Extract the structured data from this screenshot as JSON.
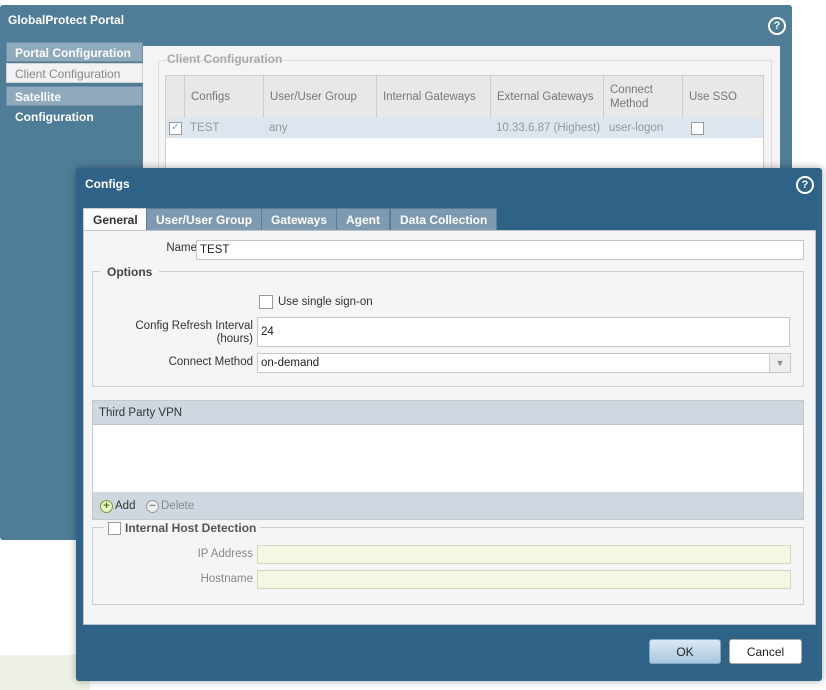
{
  "portal": {
    "title": "GlobalProtect Portal",
    "help_icon": "help-circle-icon",
    "nav": [
      {
        "label": "Portal Configuration",
        "active": false
      },
      {
        "label": "Client Configuration",
        "active": true
      },
      {
        "label": "Satellite Configuration",
        "active": false
      }
    ],
    "section_title": "Client Configuration",
    "table": {
      "headers": [
        "Configs",
        "User/User Group",
        "Internal Gateways",
        "External Gateways",
        "Connect Method",
        "Use SSO"
      ],
      "rows": [
        {
          "checked": true,
          "configs": "TEST",
          "user_group": "any",
          "internal_gateways": "",
          "external_gateways": "10.33.6.87 (Highest)",
          "connect_method": "user-logon",
          "use_sso": false
        }
      ]
    }
  },
  "dialog": {
    "title": "Configs",
    "help_icon": "help-circle-icon",
    "tabs": [
      {
        "label": "General",
        "active": true
      },
      {
        "label": "User/User Group",
        "active": false
      },
      {
        "label": "Gateways",
        "active": false
      },
      {
        "label": "Agent",
        "active": false
      },
      {
        "label": "Data Collection",
        "active": false
      }
    ],
    "name_label": "Name",
    "name_value": "TEST",
    "options_legend": "Options",
    "sso_label": "Use single sign-on",
    "sso_checked": false,
    "refresh_label_line1": "Config Refresh Interval",
    "refresh_label_line2": "(hours)",
    "refresh_value": "24",
    "connect_method_label": "Connect Method",
    "connect_method_value": "on-demand",
    "third_party_vpn_header": "Third Party VPN",
    "add_label": "Add",
    "delete_label": "Delete",
    "ihd_label": "Internal Host Detection",
    "ihd_checked": false,
    "ip_label": "IP Address",
    "ip_value": "",
    "hostname_label": "Hostname",
    "hostname_value": "",
    "ok_label": "OK",
    "cancel_label": "Cancel"
  },
  "colors": {
    "window_blue": "#4f7d98",
    "dialog_blue": "#2e6387",
    "tab_inactive": "#7d9ab1",
    "grid_header": "#cfd8e0",
    "disabled_input": "#f6f7e2"
  }
}
